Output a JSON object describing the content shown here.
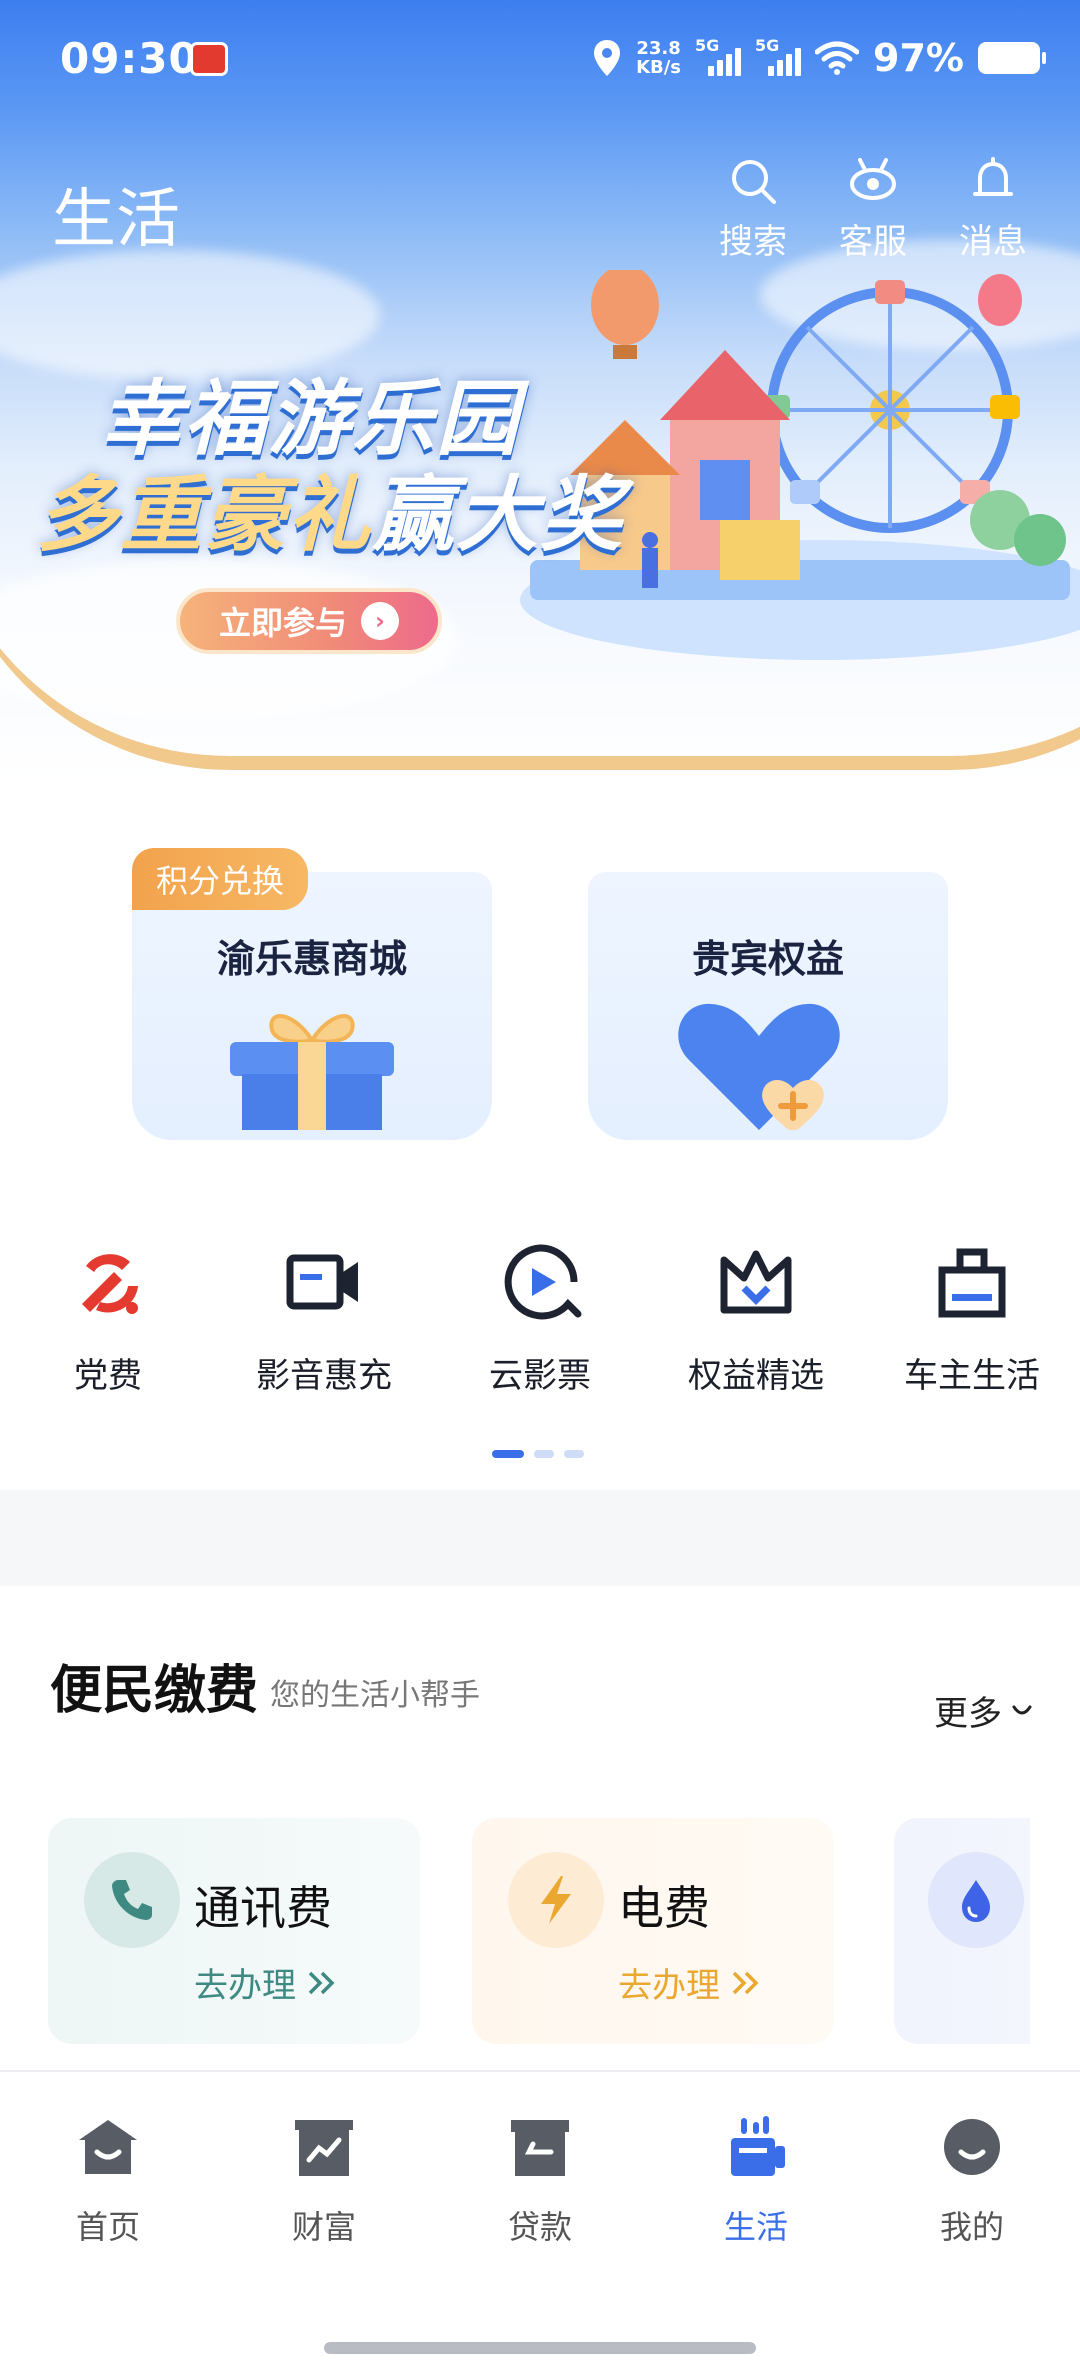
{
  "status_bar": {
    "time": "09:30",
    "net_speed_value": "23.8",
    "net_speed_unit": "KB/s",
    "sim1": "5G",
    "sim2": "5G",
    "battery": "97%"
  },
  "header": {
    "title": "生活",
    "actions": {
      "search": "搜索",
      "service": "客服",
      "messages": "消息"
    }
  },
  "banner": {
    "line1": "幸福游乐园",
    "line2_gold": "多重豪礼",
    "line2_white": "赢大奖",
    "cta": "立即参与"
  },
  "promo_cards": [
    {
      "ribbon": "积分兑换",
      "title": "渝乐惠商城"
    },
    {
      "title": "贵宾权益"
    }
  ],
  "quick_services": [
    {
      "label": "党费",
      "icon": "party-emblem-icon"
    },
    {
      "label": "影音惠充",
      "icon": "video-camera-icon"
    },
    {
      "label": "云影票",
      "icon": "play-circle-icon"
    },
    {
      "label": "权益精选",
      "icon": "crown-icon"
    },
    {
      "label": "车主生活",
      "icon": "bag-icon"
    }
  ],
  "payments": {
    "title": "便民缴费",
    "subtitle": "您的生活小帮手",
    "more": "更多",
    "items": [
      {
        "name": "通讯费",
        "action": "去办理",
        "color": "#3e8a82",
        "icon": "phone-icon"
      },
      {
        "name": "电费",
        "action": "去办理",
        "color": "#eaa830",
        "icon": "lightning-icon"
      },
      {
        "name": "",
        "action": "",
        "color": "#3e63e6",
        "icon": "water-drop-icon"
      }
    ]
  },
  "bottom_nav": [
    {
      "label": "首页",
      "active": false
    },
    {
      "label": "财富",
      "active": false
    },
    {
      "label": "贷款",
      "active": false
    },
    {
      "label": "生活",
      "active": true
    },
    {
      "label": "我的",
      "active": false
    }
  ],
  "colors": {
    "accent": "#3a6ee8",
    "nav_inactive": "#555555",
    "ribbon": "#f2a24c"
  }
}
